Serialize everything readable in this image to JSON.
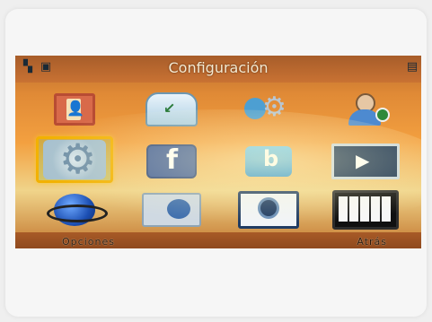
{
  "screen": {
    "title": "Configuración",
    "softkeys": {
      "left": "Opciones",
      "right": "Atrás"
    },
    "status_icons": [
      "signal-icon",
      "sim-icon",
      "battery-icon"
    ],
    "menu_icons": [
      {
        "name": "contacts-icon"
      },
      {
        "name": "inbox-icon"
      },
      {
        "name": "call-settings-icon"
      },
      {
        "name": "user-profile-icon"
      },
      {
        "name": "settings-gear-icon"
      },
      {
        "name": "facebook-icon"
      },
      {
        "name": "twitter-icon"
      },
      {
        "name": "video-player-icon"
      },
      {
        "name": "browser-globe-icon"
      },
      {
        "name": "connectivity-icon"
      },
      {
        "name": "camera-icon"
      },
      {
        "name": "music-keys-icon"
      }
    ],
    "selected_index": 4,
    "colors": {
      "accent": "#f2b100",
      "title_text": "#f4ead2",
      "background": "#e08a36"
    }
  }
}
